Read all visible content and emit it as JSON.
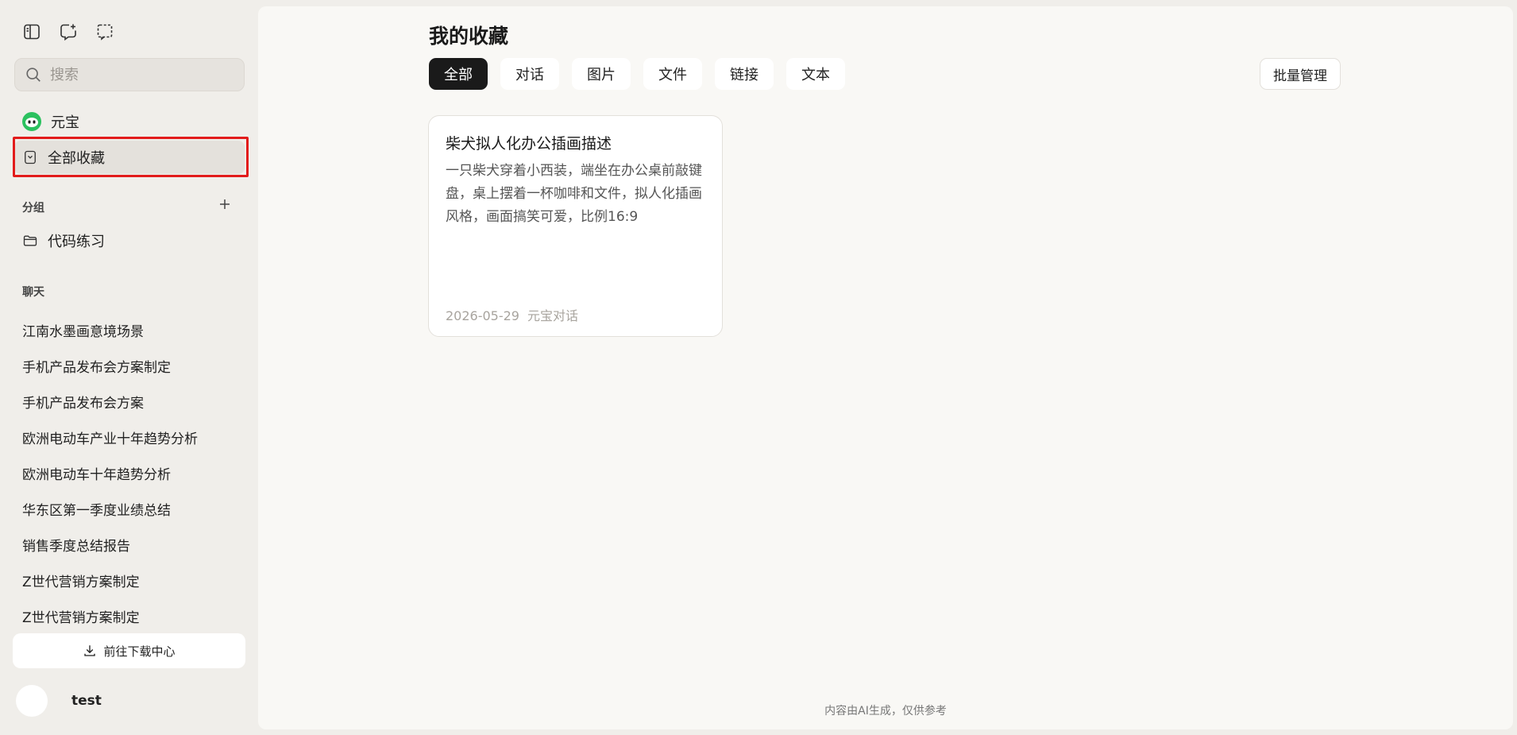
{
  "sidebar": {
    "search_placeholder": "搜索",
    "nav": {
      "yuanbao": "元宝",
      "all_favorites": "全部收藏"
    },
    "groups_label": "分组",
    "groups": [
      "代码练习"
    ],
    "chat_label": "聊天",
    "chats": [
      "江南水墨画意境场景",
      "手机产品发布会方案制定",
      "手机产品发布会方案",
      "欧洲电动车产业十年趋势分析",
      "欧洲电动车十年趋势分析",
      "华东区第一季度业绩总结",
      "销售季度总结报告",
      "Z世代营销方案制定",
      "Z世代营销方案制定"
    ],
    "download_label": "前往下载中心",
    "user_name": "test"
  },
  "main": {
    "title": "我的收藏",
    "tabs": [
      "全部",
      "对话",
      "图片",
      "文件",
      "链接",
      "文本"
    ],
    "active_tab": "全部",
    "batch_manage": "批量管理",
    "cards": [
      {
        "title": "柴犬拟人化办公插画描述",
        "body": "一只柴犬穿着小西装，端坐在办公桌前敲键盘，桌上摆着一杯咖啡和文件，拟人化插画风格，画面搞笑可爱，比例16:9",
        "date": "2026-05-29",
        "source": "元宝对话"
      }
    ],
    "footer_note": "内容由AI生成，仅供参考"
  },
  "colors": {
    "accent_active_tab": "#1a1a1a",
    "highlight_border": "#e21b1b",
    "brand_green": "#2bc15f"
  }
}
